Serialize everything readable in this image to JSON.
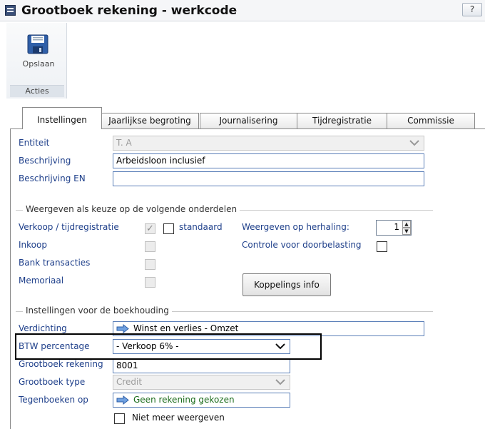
{
  "window": {
    "title": "Grootboek rekening - werkcode",
    "help_label": "?"
  },
  "toolbar": {
    "save_label": "Opslaan",
    "group_label": "Acties"
  },
  "tabs": [
    {
      "label": "Instellingen"
    },
    {
      "label": "Jaarlijkse begroting"
    },
    {
      "label": "Journalisering"
    },
    {
      "label": "Tijdregistratie"
    },
    {
      "label": "Commissie"
    }
  ],
  "fields": {
    "entiteit": {
      "label": "Entiteit",
      "value": "T. A"
    },
    "beschrijving": {
      "label": "Beschrijving",
      "value": "Arbeidsloon inclusief"
    },
    "beschrijving_en": {
      "label": "Beschrijving EN",
      "value": ""
    }
  },
  "weergeven": {
    "title": "Weergeven als keuze op de volgende onderdelen",
    "verkoop": {
      "label": "Verkoop / tijdregistratie",
      "checked": true,
      "standaard_label": "standaard"
    },
    "inkoop": {
      "label": "Inkoop"
    },
    "bank": {
      "label": "Bank transacties"
    },
    "memoriaal": {
      "label": "Memoriaal"
    },
    "herhaling": {
      "label": "Weergeven op herhaling:",
      "value": "1"
    },
    "controle": {
      "label": "Controle voor doorbelasting"
    },
    "koppelings_label": "Koppelings info"
  },
  "boekhouding": {
    "title": "Instellingen voor de boekhouding",
    "verdichting": {
      "label": "Verdichting",
      "value": "Winst en verlies - Omzet"
    },
    "btw": {
      "label": "BTW percentage",
      "value": "- Verkoop 6% -"
    },
    "grootboek_rekening": {
      "label": "Grootboek rekening",
      "value": "8001"
    },
    "grootboek_type": {
      "label": "Grootboek type",
      "value": "Credit"
    },
    "tegenboeken": {
      "label": "Tegenboeken op",
      "value": "Geen rekening gekozen"
    },
    "niet_meer_label": "Niet meer weergeven"
  },
  "colors": {
    "label_blue": "#1e3f8a",
    "link_green": "#1a6b1a",
    "arrow_blue": "#3a7bd5"
  }
}
